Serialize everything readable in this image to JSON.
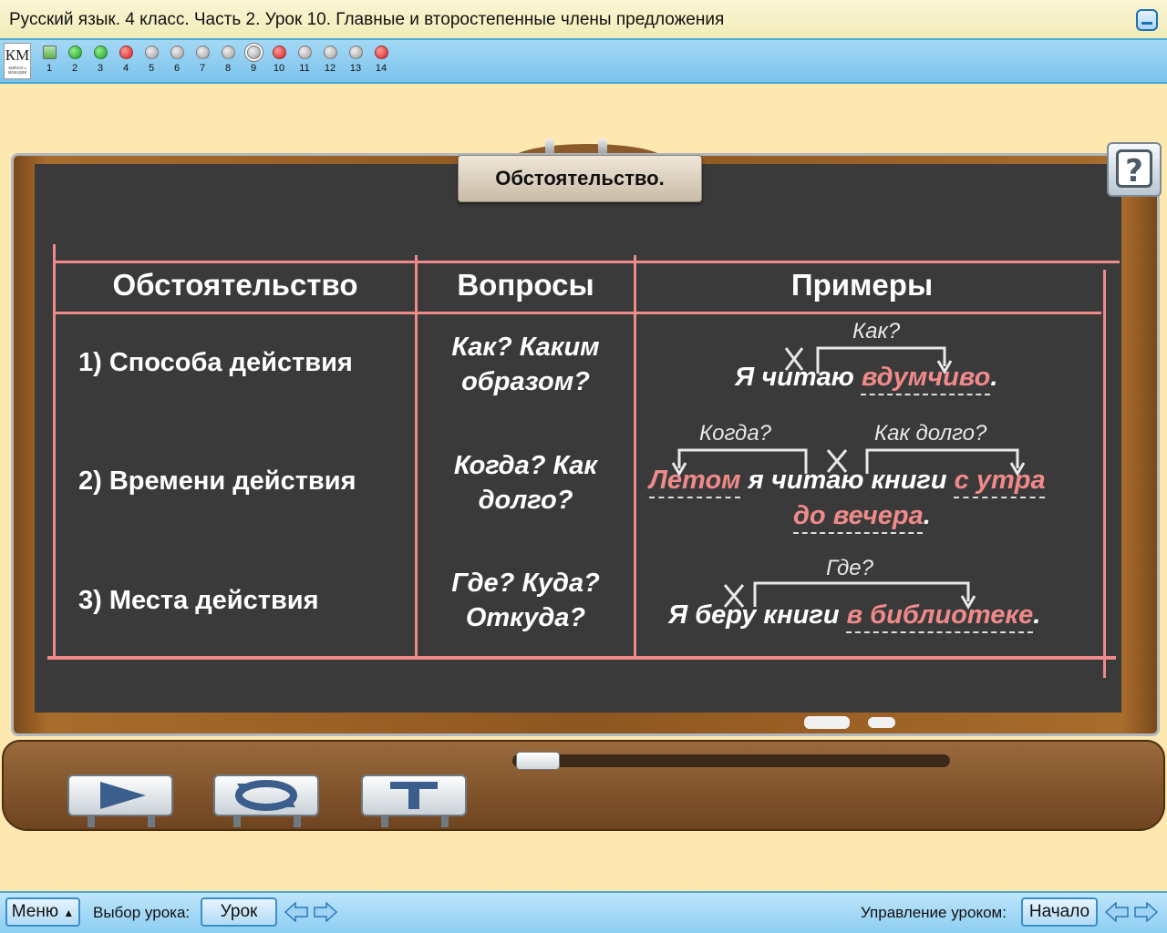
{
  "window": {
    "title": "Русский язык. 4 класс. Часть 2. Урок 10. Главные и второстепенные члены предложения"
  },
  "navbar": {
    "logo_text": "КМ",
    "logo_subtext": "КИРИЛЛ и МЕФОДИЙ",
    "slides": [
      {
        "num": "1",
        "status": "image"
      },
      {
        "num": "2",
        "status": "green"
      },
      {
        "num": "3",
        "status": "green"
      },
      {
        "num": "4",
        "status": "red"
      },
      {
        "num": "5",
        "status": "gray"
      },
      {
        "num": "6",
        "status": "gray"
      },
      {
        "num": "7",
        "status": "gray"
      },
      {
        "num": "8",
        "status": "gray"
      },
      {
        "num": "9",
        "status": "current"
      },
      {
        "num": "10",
        "status": "red"
      },
      {
        "num": "11",
        "status": "gray"
      },
      {
        "num": "12",
        "status": "gray"
      },
      {
        "num": "13",
        "status": "gray"
      },
      {
        "num": "14",
        "status": "red"
      }
    ]
  },
  "slide": {
    "title": "Обстоятельство.",
    "help_icon": "?",
    "table": {
      "headers": [
        "Обстоятельство",
        "Вопросы",
        "Примеры"
      ],
      "rows": [
        {
          "name": "1) Способа действия",
          "questions": [
            "Как? Каким",
            "образом?"
          ],
          "example": {
            "q1": "Как?",
            "cross": "X",
            "plain": "Я читаю ",
            "adverbial": "вдумчиво",
            "end": "."
          }
        },
        {
          "name": "2) Времени действия",
          "questions": [
            "Когда? Как",
            "долго?"
          ],
          "example": {
            "q1": "Когда?",
            "q2": "Как долго?",
            "cross": "X",
            "adverbial1": "Летом",
            "plain": " я читаю книги ",
            "adverbial2": "с утра",
            "adverbial3": "до вечера",
            "end": "."
          }
        },
        {
          "name": "3) Места действия",
          "questions": [
            "Где? Куда?",
            "Откуда?"
          ],
          "example": {
            "q1": "Где?",
            "cross": "X",
            "plain": "Я беру книги ",
            "adverbial": "в библиотеке",
            "end": "."
          }
        }
      ]
    }
  },
  "bottombar": {
    "menu_label": "Меню",
    "lesson_select_label": "Выбор урока:",
    "lesson_button": "Урок",
    "lesson_control_label": "Управление уроком:",
    "start_button": "Начало"
  },
  "colors": {
    "accent_pink": "#f08a8a",
    "board": "#3a3a3a",
    "background": "#fde8b0",
    "bar_blue": "#8ccdf2"
  }
}
